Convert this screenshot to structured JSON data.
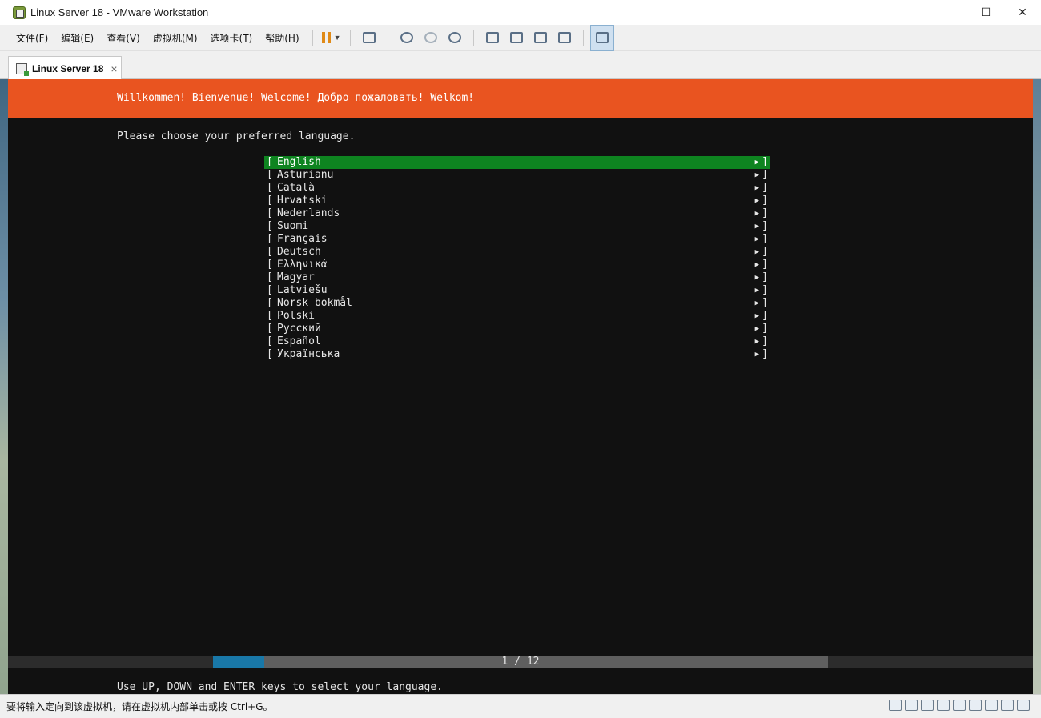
{
  "window": {
    "title": "Linux Server 18 - VMware Workstation",
    "minimize": "—",
    "maximize": "☐",
    "close": "✕"
  },
  "menu": [
    "文件(F)",
    "编辑(E)",
    "查看(V)",
    "虚拟机(M)",
    "选项卡(T)",
    "帮助(H)"
  ],
  "tab": {
    "label": "Linux Server 18",
    "close": "×"
  },
  "installer": {
    "banner": "Willkommen! Bienvenue! Welcome! Добро пожаловать! Welkom!",
    "prompt": "Please choose your preferred language.",
    "languages": [
      "English",
      "Asturianu",
      "Català",
      "Hrvatski",
      "Nederlands",
      "Suomi",
      "Français",
      "Deutsch",
      "Ελληνικά",
      "Magyar",
      "Latviešu",
      "Norsk bokmål",
      "Polski",
      "Русский",
      "Español",
      "Українська"
    ],
    "selected_index": 0,
    "left_bracket": "[",
    "right_bracket": "]",
    "arrow": "▶",
    "progress_text": "1 / 12",
    "progress_fraction": 0.0833,
    "help": "Use UP, DOWN and ENTER keys to select your language."
  },
  "status": {
    "message": "要将输入定向到该虚拟机，请在虚拟机内部单击或按 Ctrl+G。"
  },
  "colors": {
    "banner": "#e95420",
    "selected": "#0e8420",
    "progress_fill": "#1978a8"
  }
}
